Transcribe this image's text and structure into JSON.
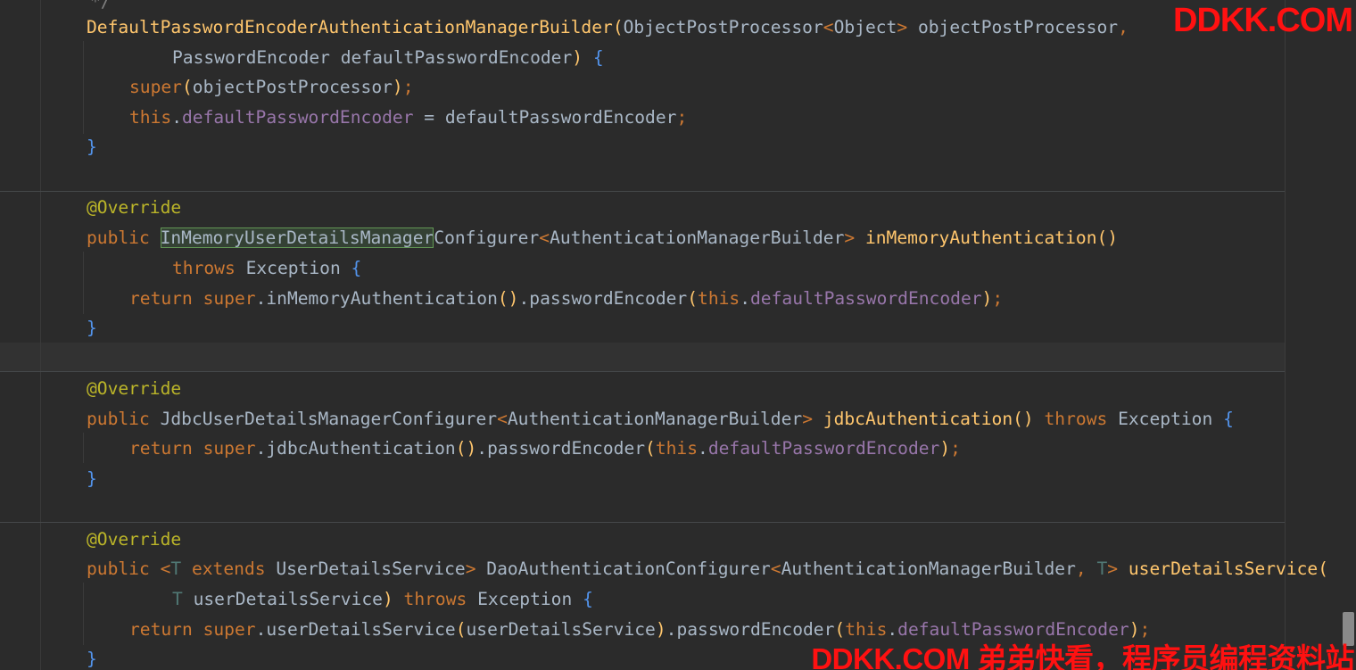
{
  "watermark": {
    "top": "DDKK.COM",
    "bottom": "DDKK.COM 弟弟快看，程序员编程资料站"
  },
  "code": {
    "comment_tail": "*/",
    "ctor_name": "DefaultPasswordEncoderAuthenticationManagerBuilder",
    "ctor_p1_type": "ObjectPostProcessor",
    "ctor_p1_generic": "Object",
    "ctor_p1_name": "objectPostProcessor",
    "ctor_p2_type": "PasswordEncoder",
    "ctor_p2_name": "defaultPasswordEncoder",
    "kw_super": "super",
    "kw_this": "this",
    "field_name": "defaultPasswordEncoder",
    "annotation": "@Override",
    "kw_public": "public",
    "kw_throws": "throws",
    "kw_return": "return",
    "kw_extends": "extends",
    "exception": "Exception",
    "m1_type_hl": "InMemoryUserDetailsManager",
    "m1_type_rest": "Configurer",
    "builder": "AuthenticationManagerBuilder",
    "m1_name": "inMemoryAuthentication",
    "m2_type": "JdbcUserDetailsManagerConfigurer",
    "m2_name": "jdbcAuthentication",
    "m3_generic": "T",
    "m3_bound": "UserDetailsService",
    "m3_type": "DaoAuthenticationConfigurer",
    "m3_name": "userDetailsService",
    "m3_param": "userDetailsService",
    "pw_method": "passwordEncoder"
  },
  "colors": {
    "background": "#2b2b2b",
    "keyword": "#cc7832",
    "method": "#ffc66d",
    "annotation": "#bbb529",
    "field": "#9876aa",
    "type_param": "#507874",
    "brace": "#5394ec",
    "text": "#a9b7c6",
    "watermark": "#ff1111"
  }
}
